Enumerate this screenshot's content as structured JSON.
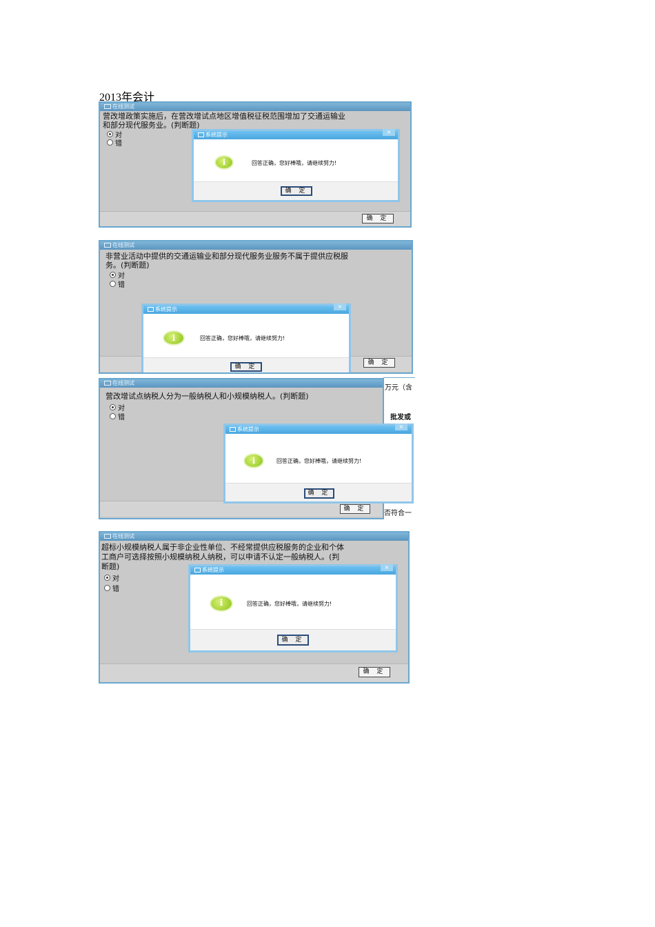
{
  "doc_title": "2013年会计",
  "window_title": "在线测试",
  "dialog_title": "系统提示",
  "dialog_close": "×",
  "dialog_message": "回答正确，您好棒哦，请继续努力!",
  "dialog_ok": "确 定",
  "footer_ok": "确 定",
  "info_glyph": "i",
  "option_true": "对",
  "option_false": "错",
  "questions": [
    {
      "line1": "营改增政策实施后，在营改增试点地区增值税征税范围增加了交通运输业",
      "line2": "和部分现代服务业。(判断题)"
    },
    {
      "line1": "非营业活动中提供的交通运输业和部分现代服务业服务不属于提供应税服",
      "line2": "务。(判断题)"
    },
    {
      "line1": "营改增试点纳税人分为一般纳税人和小规模纳税人。(判断题)",
      "line2": ""
    },
    {
      "line1": "超标小规模纳税人属于非企业性单位、不经常提供应税服务的企业和个体",
      "line2": "工商户可选择按照小规模纳税人纳税，可以申请不认定一般纳税人。(判",
      "line3": "断题)"
    }
  ],
  "background_fragments": {
    "frag_wan": "万元（含",
    "frag_pifa": "批发或",
    "frag_fou": "否符合一"
  }
}
